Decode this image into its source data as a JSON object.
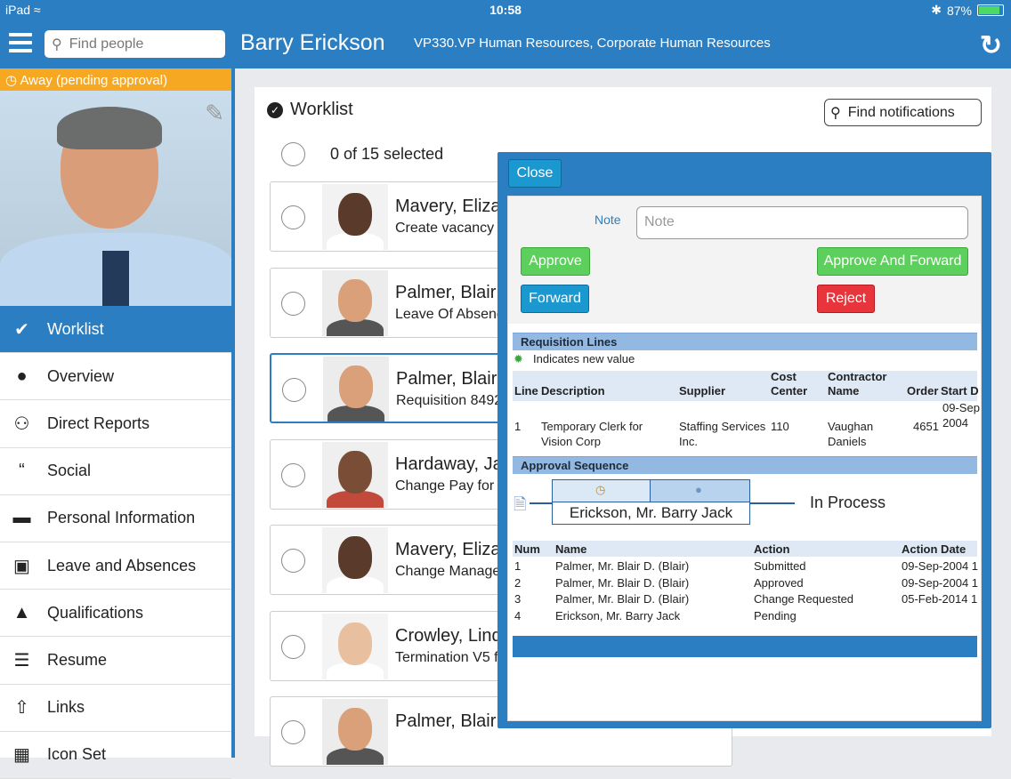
{
  "status_bar": {
    "device": "iPad",
    "time": "10:58",
    "battery": "87%",
    "battery_level": 0.87
  },
  "header": {
    "search_placeholder": "Find people",
    "name": "Barry Erickson",
    "title": "VP330.VP Human Resources, Corporate Human Resources"
  },
  "sidebar": {
    "status": "Away (pending approval)",
    "items": [
      {
        "label": "Worklist",
        "icon": "check-circle-icon"
      },
      {
        "label": "Overview",
        "icon": "person-icon"
      },
      {
        "label": "Direct Reports",
        "icon": "people-icon"
      },
      {
        "label": "Social",
        "icon": "quote-icon"
      },
      {
        "label": "Personal Information",
        "icon": "document-icon"
      },
      {
        "label": "Leave and Absences",
        "icon": "briefcase-icon"
      },
      {
        "label": "Qualifications",
        "icon": "graduation-cap-icon"
      },
      {
        "label": "Resume",
        "icon": "list-icon"
      },
      {
        "label": "Links",
        "icon": "share-icon"
      },
      {
        "label": "Icon Set",
        "icon": "image-icon"
      }
    ]
  },
  "worklist": {
    "title": "Worklist",
    "find_placeholder": "Find notifications",
    "selected": "0 of 15 selected",
    "cards": [
      {
        "name": "Mavery, Eliza",
        "desc": "Create vacancy l",
        "skin": "#5a3a2a",
        "shirt": "#ffffff",
        "bg": "#f2f2f2"
      },
      {
        "name": "Palmer, Blair",
        "desc": "Leave Of Absenc",
        "skin": "#d9a07a",
        "shirt": "#555555",
        "bg": "#ececec"
      },
      {
        "name": "Palmer, Blair",
        "desc": "Requisition 8492",
        "skin": "#d9a07a",
        "shirt": "#555555",
        "bg": "#ececec"
      },
      {
        "name": "Hardaway, Ja",
        "desc": "Change Pay for C",
        "skin": "#7a4e36",
        "shirt": "#c34a3a",
        "bg": "#efefef"
      },
      {
        "name": "Mavery, Eliza",
        "desc": "Change Manager",
        "skin": "#5a3a2a",
        "shirt": "#ffffff",
        "bg": "#f2f2f2"
      },
      {
        "name": "Crowley, Lind",
        "desc": "Termination V5 fo",
        "skin": "#e8c0a0",
        "shirt": "#ffffff",
        "bg": "#f4f4f4"
      },
      {
        "name": "Palmer, Blair",
        "desc": "",
        "skin": "#d9a07a",
        "shirt": "#555555",
        "bg": "#ececec"
      }
    ]
  },
  "detail": {
    "close": "Close",
    "note_label": "Note",
    "note_placeholder": "Note",
    "approve": "Approve",
    "approve_forward": "Approve And Forward",
    "forward": "Forward",
    "reject": "Reject",
    "req_section": "Requisition Lines",
    "new_value": "Indicates new value",
    "req_headers": {
      "line": "Line",
      "desc": "Description",
      "supplier": "Supplier",
      "cost1": "Cost",
      "cost2": "Center",
      "contr1": "Contractor",
      "contr2": "Name",
      "order": "Order",
      "start": "Start D"
    },
    "req_row": {
      "line": "1",
      "desc1": "Temporary Clerk for",
      "desc2": "Vision Corp",
      "sup1": "Staffing Services",
      "sup2": "Inc.",
      "cost": "110",
      "con1": "Vaughan",
      "con2": "Daniels",
      "order": "4651",
      "start1": "09-Sep",
      "start2": "2004"
    },
    "app_section": "Approval Sequence",
    "approver": "Erickson, Mr. Barry Jack",
    "in_process": "In Process",
    "app_headers": {
      "num": "Num",
      "name": "Name",
      "action": "Action",
      "date": "Action Date"
    },
    "app_rows": [
      {
        "num": "1",
        "name": "Palmer, Mr. Blair D. (Blair)",
        "action": "Submitted",
        "date": "09-Sep-2004 1"
      },
      {
        "num": "2",
        "name": "Palmer, Mr. Blair D. (Blair)",
        "action": "Approved",
        "date": "09-Sep-2004 1"
      },
      {
        "num": "3",
        "name": "Palmer, Mr. Blair D. (Blair)",
        "action": "Change Requested",
        "date": "05-Feb-2014 1"
      },
      {
        "num": "4",
        "name": "Erickson, Mr. Barry Jack",
        "action": "Pending",
        "date": ""
      }
    ]
  }
}
